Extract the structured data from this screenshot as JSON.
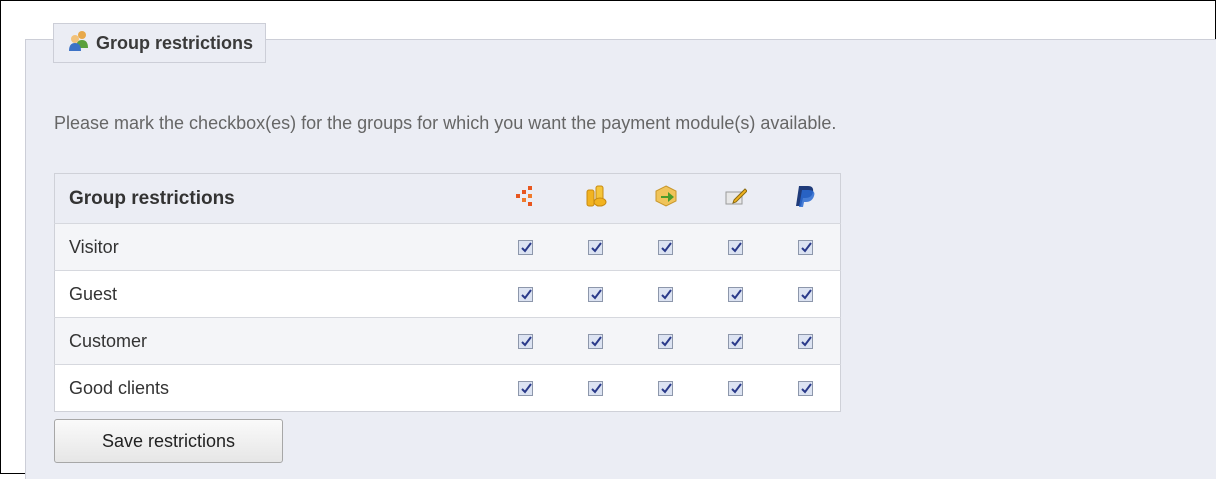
{
  "fieldset": {
    "legend": "Group restrictions",
    "legend_icon": "group-users-icon"
  },
  "description": "Please mark the checkbox(es) for the groups for which you want the payment module(s) available.",
  "table": {
    "header_label": "Group restrictions",
    "modules": [
      {
        "name": "payment-module-1",
        "icon": "red-blocks-icon",
        "color": "#e8561f"
      },
      {
        "name": "payment-module-2",
        "icon": "gold-coins-icon",
        "color": "#f2b320"
      },
      {
        "name": "payment-module-3",
        "icon": "green-arrow-box-icon",
        "color": "#4c9b2c"
      },
      {
        "name": "payment-module-4",
        "icon": "check-pencil-icon",
        "color": "#8c8c8c"
      },
      {
        "name": "payment-module-5",
        "icon": "paypal-icon",
        "color": "#1f3b7a"
      }
    ],
    "rows": [
      {
        "group": "Visitor",
        "checked": [
          true,
          true,
          true,
          true,
          true
        ]
      },
      {
        "group": "Guest",
        "checked": [
          true,
          true,
          true,
          true,
          true
        ]
      },
      {
        "group": "Customer",
        "checked": [
          true,
          true,
          true,
          true,
          true
        ]
      },
      {
        "group": "Good clients",
        "checked": [
          true,
          true,
          true,
          true,
          true
        ]
      }
    ]
  },
  "save_button": "Save restrictions"
}
